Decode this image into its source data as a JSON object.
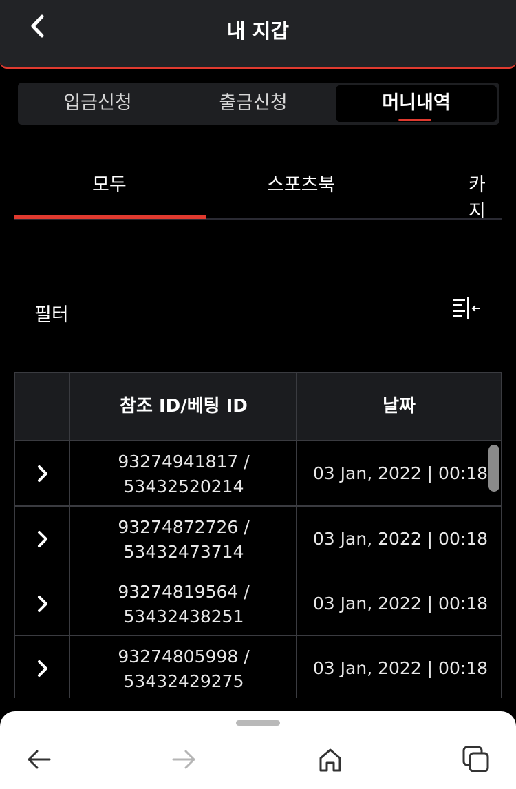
{
  "header": {
    "title": "내 지갑"
  },
  "segments": [
    {
      "label": "입금신청",
      "active": false
    },
    {
      "label": "출금신청",
      "active": false
    },
    {
      "label": "머니내역",
      "active": true
    }
  ],
  "tabs": [
    {
      "label": "모두",
      "active": true
    },
    {
      "label": "스포츠북",
      "active": false
    },
    {
      "label": "카지",
      "active": false
    }
  ],
  "filter": {
    "label": "필터"
  },
  "table": {
    "columns": [
      "",
      "참조 ID/베팅 ID",
      "날짜"
    ],
    "rows": [
      {
        "ref_id": "93274941817 /",
        "bet_id": "53432520214",
        "date": "03 Jan, 2022 | 00:18"
      },
      {
        "ref_id": "93274872726 /",
        "bet_id": "53432473714",
        "date": "03 Jan, 2022 | 00:18"
      },
      {
        "ref_id": "93274819564 /",
        "bet_id": "53432438251",
        "date": "03 Jan, 2022 | 00:18"
      },
      {
        "ref_id": "93274805998 /",
        "bet_id": "53432429275",
        "date": "03 Jan, 2022 | 00:18"
      }
    ]
  },
  "colors": {
    "accent": "#e03a2f",
    "background": "#000000",
    "surface": "#222326"
  },
  "icons": {
    "back": "chevron-left-icon",
    "filter": "filter-lines-icon",
    "row_expand": "chevron-right-icon",
    "nav_back": "arrow-left-icon",
    "nav_forward": "arrow-right-icon",
    "nav_home": "home-icon",
    "nav_tabs": "tabs-icon"
  }
}
